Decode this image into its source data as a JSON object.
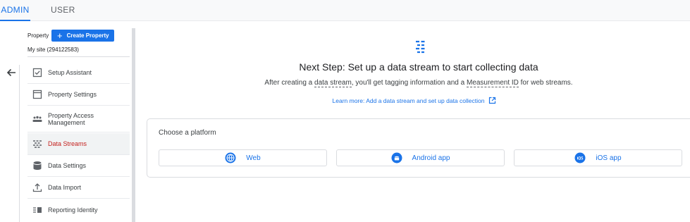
{
  "tabs": [
    {
      "label": "ADMIN",
      "active": true
    },
    {
      "label": "USER",
      "active": false
    }
  ],
  "property": {
    "label": "Property",
    "create_label": "Create Property",
    "site": "My site (294122583)"
  },
  "sidebar": {
    "items": [
      {
        "label": "Setup Assistant",
        "icon": "checkbox-icon",
        "active": false
      },
      {
        "label": "Property Settings",
        "icon": "square-settings-icon",
        "active": false
      },
      {
        "label": "Property Access Management",
        "icon": "people-icon",
        "active": false
      },
      {
        "label": "Data Streams",
        "icon": "data-streams-icon",
        "active": true
      },
      {
        "label": "Data Settings",
        "icon": "database-icon",
        "active": false
      },
      {
        "label": "Data Import",
        "icon": "upload-icon",
        "active": false
      },
      {
        "label": "Reporting Identity",
        "icon": "identity-icon",
        "active": false
      }
    ]
  },
  "main": {
    "headline": "Next Step: Set up a data stream to start collecting data",
    "sub_before": "After creating a ",
    "sub_link1": "data stream",
    "sub_middle": ", you'll get tagging information and a ",
    "sub_link2": "Measurement ID",
    "sub_after": " for web streams.",
    "learn_more": "Learn more: Add a data stream and set up data collection"
  },
  "platform": {
    "title": "Choose a platform",
    "options": [
      {
        "label": "Web",
        "icon": "globe-icon"
      },
      {
        "label": "Android app",
        "icon": "android-icon"
      },
      {
        "label": "iOS app",
        "icon": "ios-icon"
      }
    ]
  },
  "colors": {
    "accent": "#1a73e8",
    "active_nav": "#c5221f"
  }
}
